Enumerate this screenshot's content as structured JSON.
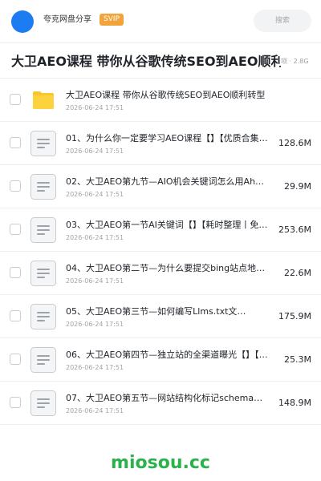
{
  "header": {
    "app_name": "夸克网盘分享",
    "badge": "SVIP",
    "search_placeholder": "搜索",
    "avatar_color": "#1e7cf2",
    "badge_color": "#f2a33a"
  },
  "share": {
    "title": "大卫AEO课程 带你从谷歌传统SEO到AEO顺利转型",
    "meta": "项 · 2.8G"
  },
  "files": [
    {
      "type": "folder-icon",
      "name": "大卫AEO课程 带你从谷歌传统SEO到AEO顺利转型",
      "date": "2026-06-24 17:51",
      "size": ""
    },
    {
      "type": "file-icon",
      "name": "01、为什么你一定要学习AEO课程【】【优质合集丨…",
      "date": "2026-06-24 17:51",
      "size": "128.6M"
    },
    {
      "type": "file-icon",
      "name": "02、大卫AEO第九节—AIO机会关键词怎么用Ah…",
      "date": "2026-06-24 17:51",
      "size": "29.9M"
    },
    {
      "type": "file-icon",
      "name": "03、大卫AEO第一节AI关键词【】【耗时整理丨免…",
      "date": "2026-06-24 17:51",
      "size": "253.6M"
    },
    {
      "type": "file-icon",
      "name": "04、大卫AEO第二节—为什么要提交bing站点地…",
      "date": "2026-06-24 17:51",
      "size": "22.6M"
    },
    {
      "type": "file-icon",
      "name": "05、大卫AEO第三节—如何编写Llms.txt文…",
      "date": "2026-06-24 17:51",
      "size": "175.9M"
    },
    {
      "type": "file-icon",
      "name": "06、大卫AEO第四节—独立站的全渠道曝光【】【免…",
      "date": "2026-06-24 17:51",
      "size": "25.3M"
    },
    {
      "type": "file-icon",
      "name": "07、大卫AEO第五节—网站结构化标记schema…",
      "date": "2026-06-24 17:51",
      "size": "148.9M"
    }
  ],
  "watermark": "miosou.cc"
}
